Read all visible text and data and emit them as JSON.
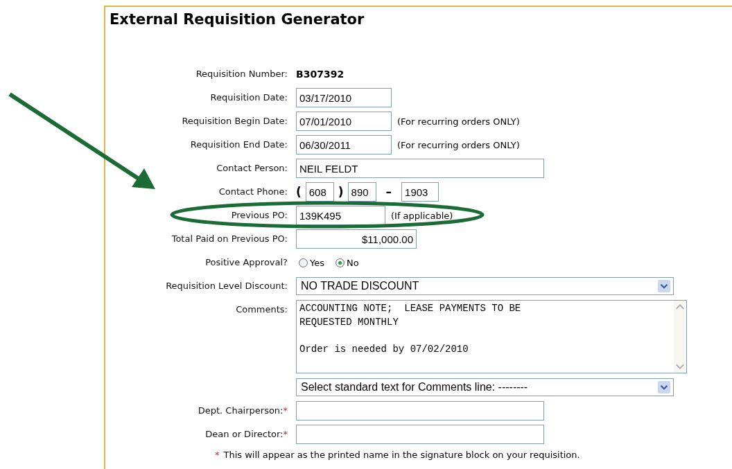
{
  "title": "External Requisition Generator",
  "fields": [
    {
      "kind": "static",
      "label": "Requisition Number:",
      "value": "B307392"
    },
    {
      "kind": "date",
      "label": "Requisition Date:",
      "value": "03/17/2010"
    },
    {
      "kind": "date",
      "label": "Requisition Begin Date:",
      "value": "07/01/2010",
      "note": "(For recurring orders ONLY)"
    },
    {
      "kind": "date",
      "label": "Requisition End Date:",
      "value": "06/30/2011",
      "note": "(For recurring orders ONLY)"
    },
    {
      "kind": "text",
      "label": "Contact Person:",
      "value": "NEIL FELDT"
    },
    {
      "kind": "phone",
      "label": "Contact Phone:",
      "open": "(",
      "area": "608",
      "close": ")",
      "prefix": "890",
      "dash": "–",
      "line": "1903"
    },
    {
      "kind": "short",
      "label": "Previous PO:",
      "value": "139K495",
      "note": "(If applicable)"
    },
    {
      "kind": "amount",
      "label": "Total Paid on Previous PO:",
      "value": "$11,000.00"
    },
    {
      "kind": "radio",
      "label": "Positive Approval?",
      "options": [
        {
          "label": "Yes",
          "selected": false
        },
        {
          "label": "No",
          "selected": true
        }
      ]
    },
    {
      "kind": "select",
      "label": "Requisition Level Discount:",
      "value": "NO TRADE DISCOUNT"
    },
    {
      "kind": "textarea",
      "label": "Comments:",
      "value": "ACCOUNTING NOTE;  LEASE PAYMENTS TO BE\nREQUESTED MONTHLY\n\nOrder is needed by 07/02/2010"
    },
    {
      "kind": "select",
      "value": "Select standard text for Comments line: --------"
    },
    {
      "kind": "text",
      "label": "Dept. Chairperson:",
      "marker": "*"
    },
    {
      "kind": "text",
      "label": "Dean or Director:",
      "marker": "*"
    }
  ],
  "footnote": {
    "marker": "*",
    "text": "This will appear as the printed name in the signature block on your requisition."
  }
}
